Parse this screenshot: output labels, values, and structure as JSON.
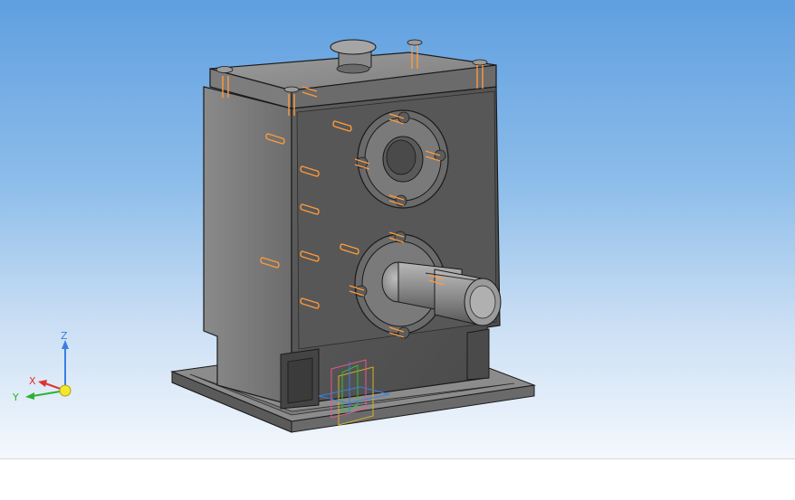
{
  "viewport": {
    "background_top": "#5f9fe0",
    "background_bottom": "#f4f8fd",
    "model_color": "#6e6e6e",
    "edge_color": "#1a1a1a",
    "hole_highlight_color": "#ff9a3c"
  },
  "triad": {
    "x_label": "X",
    "y_label": "Y",
    "z_label": "Z",
    "x_color": "#e03030",
    "y_color": "#30b030",
    "z_color": "#3a7fe0",
    "origin_color": "#f2e830"
  },
  "statusbar": {}
}
